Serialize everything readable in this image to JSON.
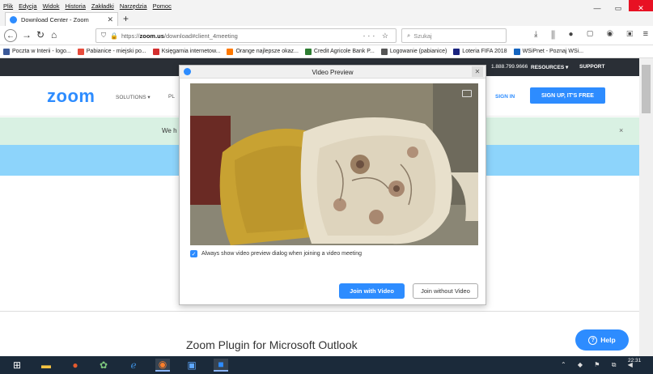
{
  "browser": {
    "menu": [
      "Plik",
      "Edycja",
      "Widok",
      "Historia",
      "Zakładki",
      "Narzędzia",
      "Pomoc"
    ],
    "tab_title": "Download Center - Zoom",
    "url_scheme": "https://",
    "url_host": "zoom.us",
    "url_path": "/download#client_4meeting",
    "search_placeholder": "Szukaj",
    "bookmarks": [
      {
        "label": "Poczta w Interii - logo...",
        "color": "#3b5998"
      },
      {
        "label": "Pabianice - miejski po...",
        "color": "#e74c3c"
      },
      {
        "label": "Księgarnia internetow...",
        "color": "#d32f2f"
      },
      {
        "label": "Orange najlepsze okaz...",
        "color": "#ff7900"
      },
      {
        "label": "Credit Agricole Bank P...",
        "color": "#2e7d32"
      },
      {
        "label": "Logowanie (pabianice)",
        "color": "#555555"
      },
      {
        "label": "Loteria FIFA 2018",
        "color": "#1a237e"
      },
      {
        "label": "WSiPnet - Poznaj WSi...",
        "color": "#1565c0"
      }
    ]
  },
  "zoom_site": {
    "phone": "1.888.799.9666",
    "resources": "RESOURCES ▾",
    "support": "SUPPORT",
    "logo": "zoom",
    "solutions": "SOLUTIONS ▾",
    "plans_partial": "PL",
    "signin": "SIGN IN",
    "signup": "SIGN UP, IT'S FREE",
    "banner_partial": "We h",
    "plugin_title": "Zoom Plugin for Microsoft Outlook",
    "help": "Help"
  },
  "dialog": {
    "title": "Video Preview",
    "checkbox_label": "Always show video preview dialog when joining a video meeting",
    "join_video": "Join with Video",
    "join_no_video": "Join without Video"
  },
  "taskbar": {
    "time": "22:31"
  }
}
